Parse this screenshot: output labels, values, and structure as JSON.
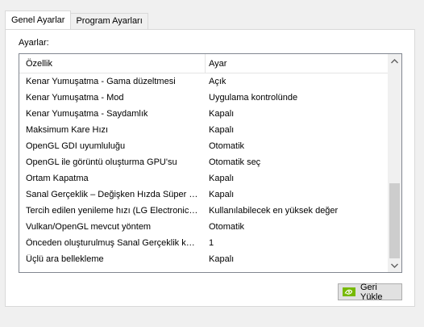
{
  "tabs": [
    {
      "label": "Genel Ayarlar",
      "active": true
    },
    {
      "label": "Program Ayarları",
      "active": false
    }
  ],
  "panel": {
    "label": "Ayarlar:",
    "columns": {
      "feature": "Özellik",
      "setting": "Ayar"
    },
    "rows": [
      {
        "feature": "Kenar Yumuşatma - Gama düzeltmesi",
        "value": "Açık"
      },
      {
        "feature": "Kenar Yumuşatma - Mod",
        "value": "Uygulama kontrolünde"
      },
      {
        "feature": "Kenar Yumuşatma - Saydamlık",
        "value": "Kapalı"
      },
      {
        "feature": "Maksimum Kare Hızı",
        "value": "Kapalı"
      },
      {
        "feature": "OpenGL GDI uyumluluğu",
        "value": "Otomatik"
      },
      {
        "feature": "OpenGL ile görüntü oluşturma GPU'su",
        "value": "Otomatik seç"
      },
      {
        "feature": "Ortam Kapatma",
        "value": "Kapalı"
      },
      {
        "feature": "Sanal Gerçeklik – Değişken Hızda Süper Ör...",
        "value": "Kapalı"
      },
      {
        "feature": "Tercih edilen yenileme hızı (LG Electronics ...",
        "value": "Kullanılabilecek en yüksek değer"
      },
      {
        "feature": "Vulkan/OpenGL mevcut yöntem",
        "value": "Otomatik"
      },
      {
        "feature": "Önceden oluşturulmuş Sanal Gerçeklik kar...",
        "value": "1"
      },
      {
        "feature": "Üçlü ara bellekleme",
        "value": "Kapalı"
      }
    ],
    "restore_button": "Geri Yükle"
  },
  "colors": {
    "accent": "#76b900",
    "border": "#828790",
    "scroll_thumb": "#cdcdcd"
  },
  "icons": {
    "up": "chevron-up-icon",
    "down": "chevron-down-icon",
    "nvidia": "nvidia-logo-icon"
  }
}
